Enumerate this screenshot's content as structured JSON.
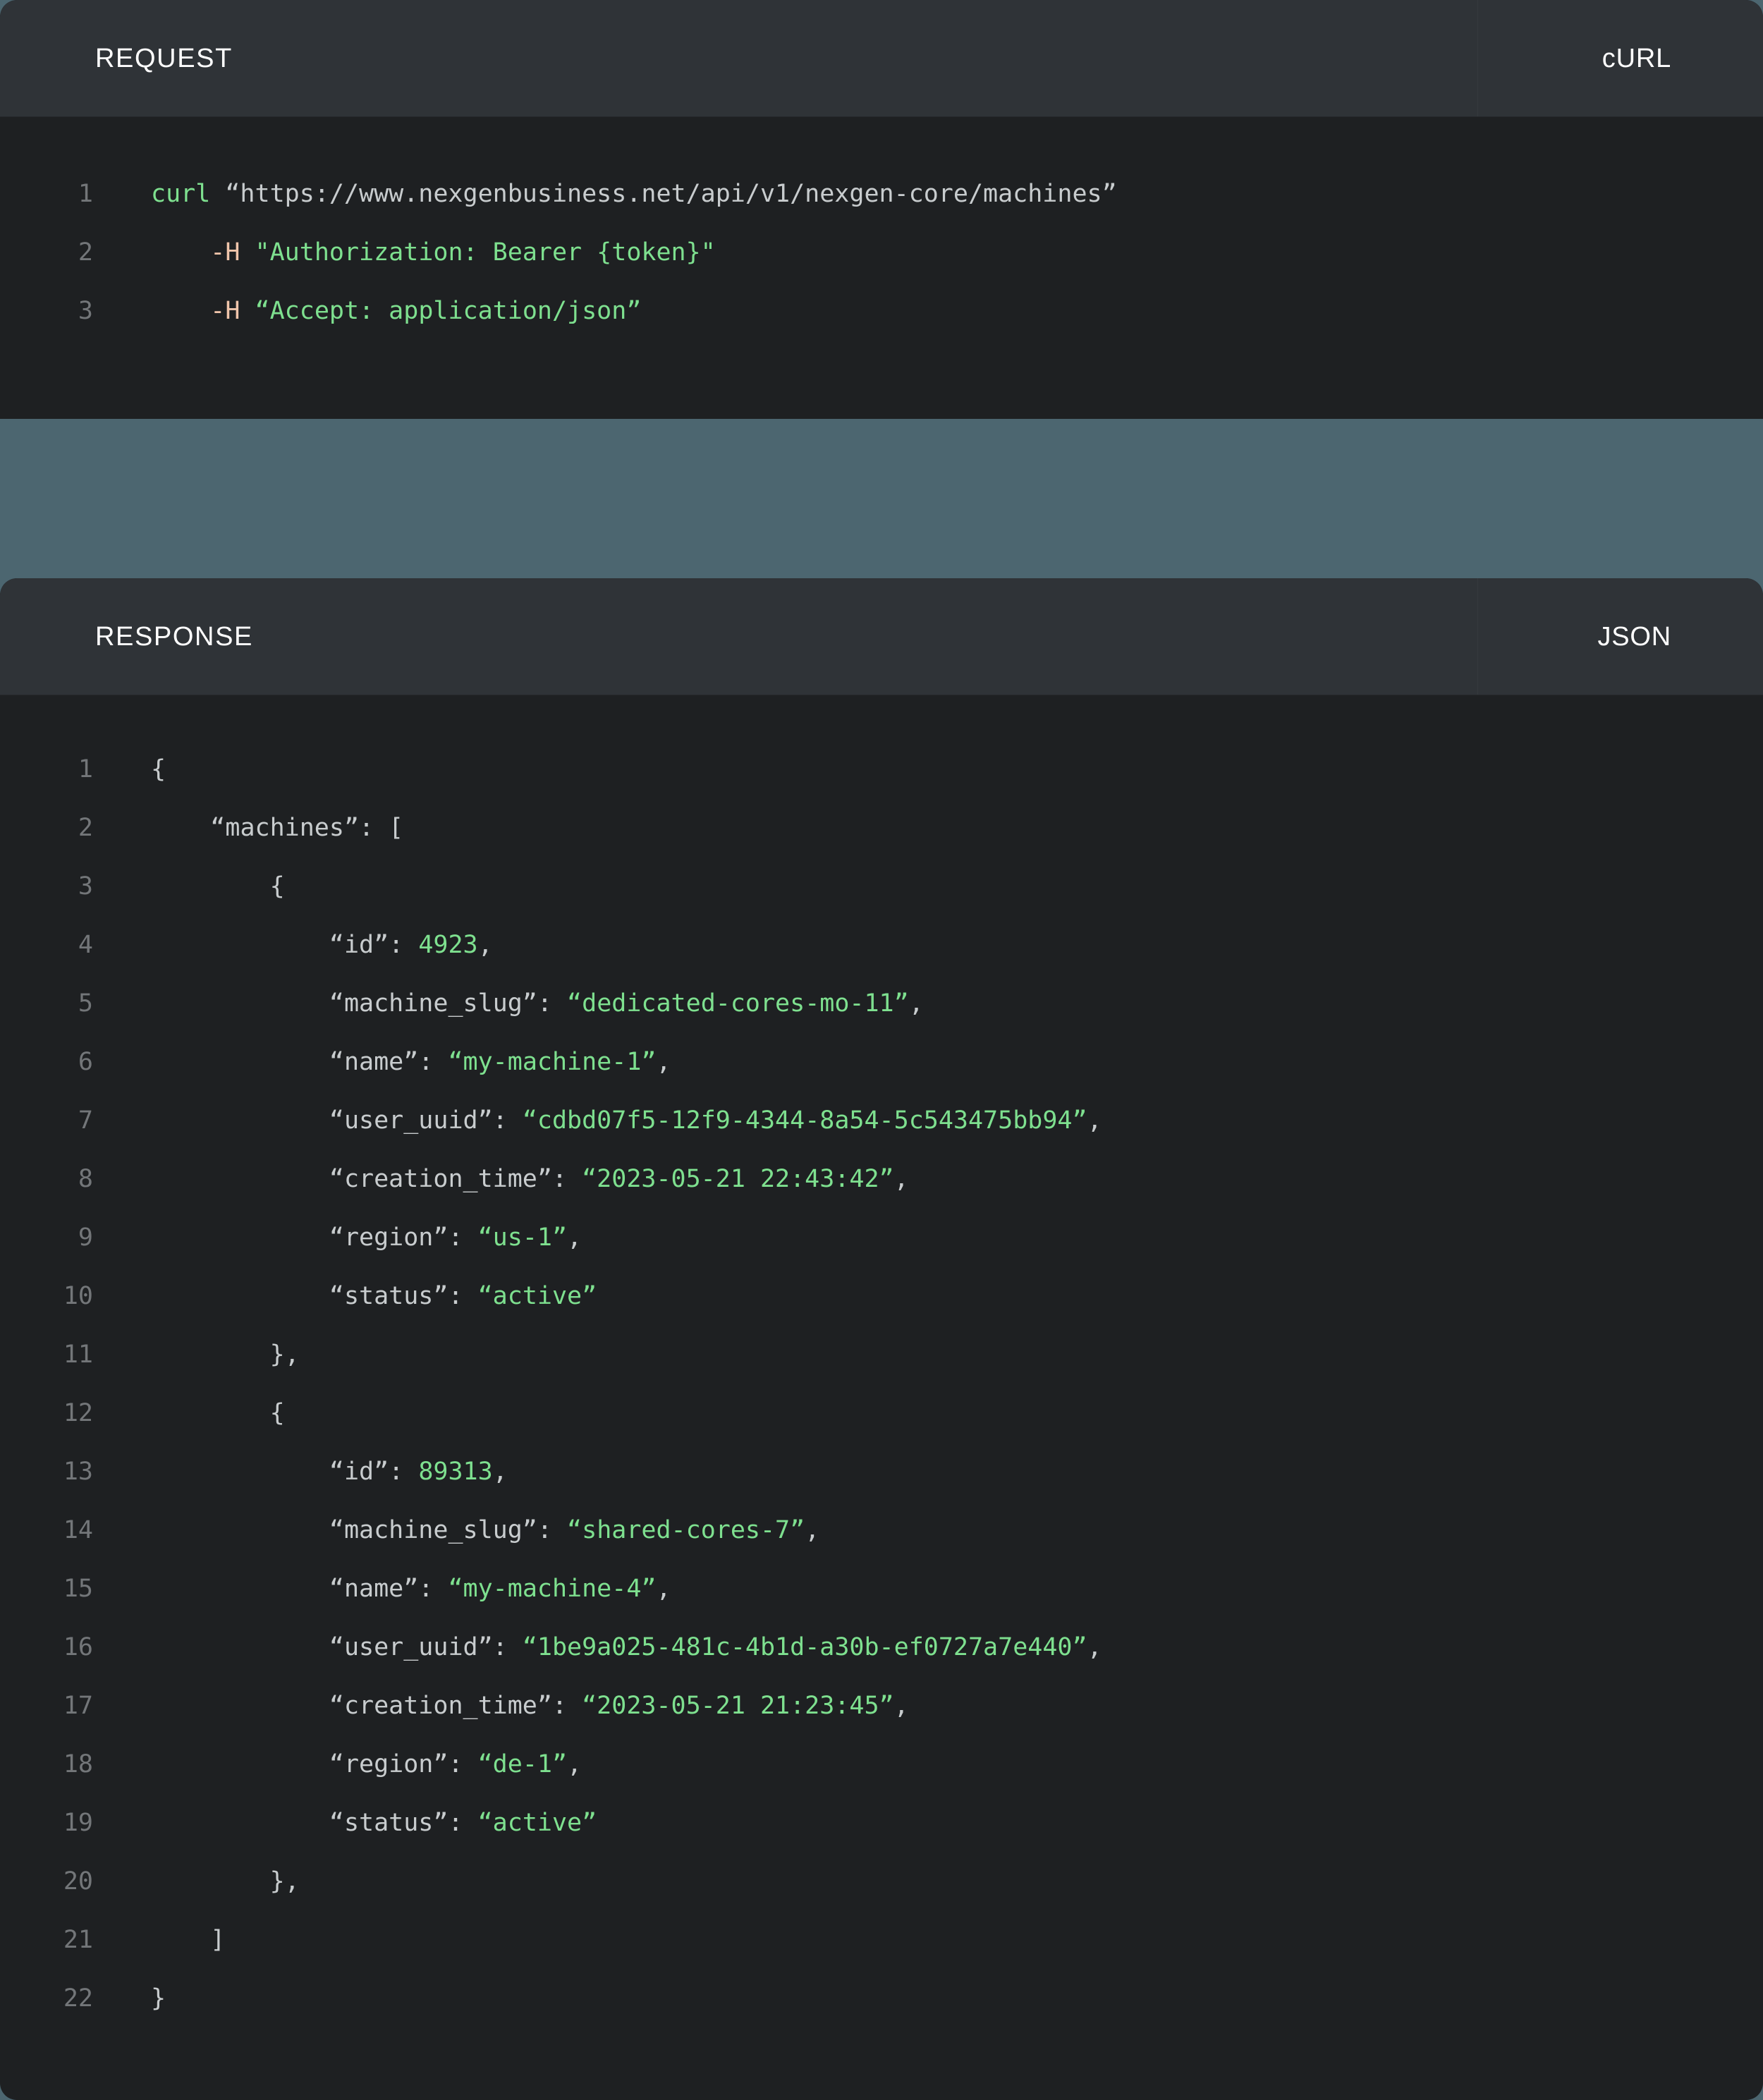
{
  "theme": {
    "page_background": "#4c6670",
    "panel_background": "#1e2022",
    "panel_header_background": "#2f3337",
    "line_number_color": "#737679",
    "default_code_color": "#c8ccce",
    "string_color": "#7ee08f",
    "number_color": "#7ee08f",
    "flag_color": "#f0c5ab",
    "header_text_color": "#ffffff"
  },
  "request": {
    "title": "REQUEST",
    "language": "cURL",
    "code_lines": [
      {
        "n": "1",
        "tokens": [
          {
            "text": "curl ",
            "cls": "t-green"
          },
          {
            "text": "“https://www.nexgenbusiness.net/api/v1/nexgen-core/machines”",
            "cls": "t-plain"
          }
        ]
      },
      {
        "n": "2",
        "tokens": [
          {
            "text": "    ",
            "cls": "t-plain"
          },
          {
            "text": "-H",
            "cls": "t-peach"
          },
          {
            "text": " ",
            "cls": "t-plain"
          },
          {
            "text": "\"Authorization: Bearer {token}\"",
            "cls": "t-green"
          }
        ]
      },
      {
        "n": "3",
        "tokens": [
          {
            "text": "    ",
            "cls": "t-plain"
          },
          {
            "text": "-H",
            "cls": "t-peach"
          },
          {
            "text": " ",
            "cls": "t-plain"
          },
          {
            "text": "“Accept: application/json”",
            "cls": "t-green"
          }
        ]
      }
    ],
    "raw": "curl “https://www.nexgenbusiness.net/api/v1/nexgen-core/machines”\n    -H \"Authorization: Bearer {token}\"\n    -H “Accept: application/json”"
  },
  "response": {
    "title": "RESPONSE",
    "language": "JSON",
    "code_lines": [
      {
        "n": "1",
        "tokens": [
          {
            "text": "{",
            "cls": "t-punct"
          }
        ]
      },
      {
        "n": "2",
        "tokens": [
          {
            "text": "    ",
            "cls": "t-punct"
          },
          {
            "text": "“machines”",
            "cls": "t-key"
          },
          {
            "text": ": [",
            "cls": "t-punct"
          }
        ]
      },
      {
        "n": "3",
        "tokens": [
          {
            "text": "        {",
            "cls": "t-punct"
          }
        ]
      },
      {
        "n": "4",
        "tokens": [
          {
            "text": "            ",
            "cls": "t-punct"
          },
          {
            "text": "“id”",
            "cls": "t-key"
          },
          {
            "text": ": ",
            "cls": "t-punct"
          },
          {
            "text": "4923",
            "cls": "t-num"
          },
          {
            "text": ",",
            "cls": "t-punct"
          }
        ]
      },
      {
        "n": "5",
        "tokens": [
          {
            "text": "            ",
            "cls": "t-punct"
          },
          {
            "text": "“machine_slug”",
            "cls": "t-key"
          },
          {
            "text": ": ",
            "cls": "t-punct"
          },
          {
            "text": "“dedicated-cores-mo-11”",
            "cls": "t-str"
          },
          {
            "text": ",",
            "cls": "t-punct"
          }
        ]
      },
      {
        "n": "6",
        "tokens": [
          {
            "text": "            ",
            "cls": "t-punct"
          },
          {
            "text": "“name”",
            "cls": "t-key"
          },
          {
            "text": ": ",
            "cls": "t-punct"
          },
          {
            "text": "“my-machine-1”",
            "cls": "t-str"
          },
          {
            "text": ",",
            "cls": "t-punct"
          }
        ]
      },
      {
        "n": "7",
        "tokens": [
          {
            "text": "            ",
            "cls": "t-punct"
          },
          {
            "text": "“user_uuid”",
            "cls": "t-key"
          },
          {
            "text": ": ",
            "cls": "t-punct"
          },
          {
            "text": "“cdbd07f5-12f9-4344-8a54-5c543475bb94”",
            "cls": "t-str"
          },
          {
            "text": ",",
            "cls": "t-punct"
          }
        ]
      },
      {
        "n": "8",
        "tokens": [
          {
            "text": "            ",
            "cls": "t-punct"
          },
          {
            "text": "“creation_time”",
            "cls": "t-key"
          },
          {
            "text": ": ",
            "cls": "t-punct"
          },
          {
            "text": "“2023-05-21 22:43:42”",
            "cls": "t-str"
          },
          {
            "text": ",",
            "cls": "t-punct"
          }
        ]
      },
      {
        "n": "9",
        "tokens": [
          {
            "text": "            ",
            "cls": "t-punct"
          },
          {
            "text": "“region”",
            "cls": "t-key"
          },
          {
            "text": ": ",
            "cls": "t-punct"
          },
          {
            "text": "“us-1”",
            "cls": "t-str"
          },
          {
            "text": ",",
            "cls": "t-punct"
          }
        ]
      },
      {
        "n": "10",
        "tokens": [
          {
            "text": "            ",
            "cls": "t-punct"
          },
          {
            "text": "“status”",
            "cls": "t-key"
          },
          {
            "text": ": ",
            "cls": "t-punct"
          },
          {
            "text": "“active”",
            "cls": "t-str"
          }
        ]
      },
      {
        "n": "11",
        "tokens": [
          {
            "text": "        },",
            "cls": "t-punct"
          }
        ]
      },
      {
        "n": "12",
        "tokens": [
          {
            "text": "        {",
            "cls": "t-punct"
          }
        ]
      },
      {
        "n": "13",
        "tokens": [
          {
            "text": "            ",
            "cls": "t-punct"
          },
          {
            "text": "“id”",
            "cls": "t-key"
          },
          {
            "text": ": ",
            "cls": "t-punct"
          },
          {
            "text": "89313",
            "cls": "t-num"
          },
          {
            "text": ",",
            "cls": "t-punct"
          }
        ]
      },
      {
        "n": "14",
        "tokens": [
          {
            "text": "            ",
            "cls": "t-punct"
          },
          {
            "text": "“machine_slug”",
            "cls": "t-key"
          },
          {
            "text": ": ",
            "cls": "t-punct"
          },
          {
            "text": "“shared-cores-7”",
            "cls": "t-str"
          },
          {
            "text": ",",
            "cls": "t-punct"
          }
        ]
      },
      {
        "n": "15",
        "tokens": [
          {
            "text": "            ",
            "cls": "t-punct"
          },
          {
            "text": "“name”",
            "cls": "t-key"
          },
          {
            "text": ": ",
            "cls": "t-punct"
          },
          {
            "text": "“my-machine-4”",
            "cls": "t-str"
          },
          {
            "text": ",",
            "cls": "t-punct"
          }
        ]
      },
      {
        "n": "16",
        "tokens": [
          {
            "text": "            ",
            "cls": "t-punct"
          },
          {
            "text": "“user_uuid”",
            "cls": "t-key"
          },
          {
            "text": ": ",
            "cls": "t-punct"
          },
          {
            "text": "“1be9a025-481c-4b1d-a30b-ef0727a7e440”",
            "cls": "t-str"
          },
          {
            "text": ",",
            "cls": "t-punct"
          }
        ]
      },
      {
        "n": "17",
        "tokens": [
          {
            "text": "            ",
            "cls": "t-punct"
          },
          {
            "text": "“creation_time”",
            "cls": "t-key"
          },
          {
            "text": ": ",
            "cls": "t-punct"
          },
          {
            "text": "“2023-05-21 21:23:45”",
            "cls": "t-str"
          },
          {
            "text": ",",
            "cls": "t-punct"
          }
        ]
      },
      {
        "n": "18",
        "tokens": [
          {
            "text": "            ",
            "cls": "t-punct"
          },
          {
            "text": "“region”",
            "cls": "t-key"
          },
          {
            "text": ": ",
            "cls": "t-punct"
          },
          {
            "text": "“de-1”",
            "cls": "t-str"
          },
          {
            "text": ",",
            "cls": "t-punct"
          }
        ]
      },
      {
        "n": "19",
        "tokens": [
          {
            "text": "            ",
            "cls": "t-punct"
          },
          {
            "text": "“status”",
            "cls": "t-key"
          },
          {
            "text": ": ",
            "cls": "t-punct"
          },
          {
            "text": "“active”",
            "cls": "t-str"
          }
        ]
      },
      {
        "n": "20",
        "tokens": [
          {
            "text": "        },",
            "cls": "t-punct"
          }
        ]
      },
      {
        "n": "21",
        "tokens": [
          {
            "text": "    ]",
            "cls": "t-punct"
          }
        ]
      },
      {
        "n": "22",
        "tokens": [
          {
            "text": "}",
            "cls": "t-punct"
          }
        ]
      }
    ],
    "machines": [
      {
        "id": 4923,
        "machine_slug": "dedicated-cores-mo-11",
        "name": "my-machine-1",
        "user_uuid": "cdbd07f5-12f9-4344-8a54-5c543475bb94",
        "creation_time": "2023-05-21 22:43:42",
        "region": "us-1",
        "status": "active"
      },
      {
        "id": 89313,
        "machine_slug": "shared-cores-7",
        "name": "my-machine-4",
        "user_uuid": "1be9a025-481c-4b1d-a30b-ef0727a7e440",
        "creation_time": "2023-05-21 21:23:45",
        "region": "de-1",
        "status": "active"
      }
    ]
  }
}
